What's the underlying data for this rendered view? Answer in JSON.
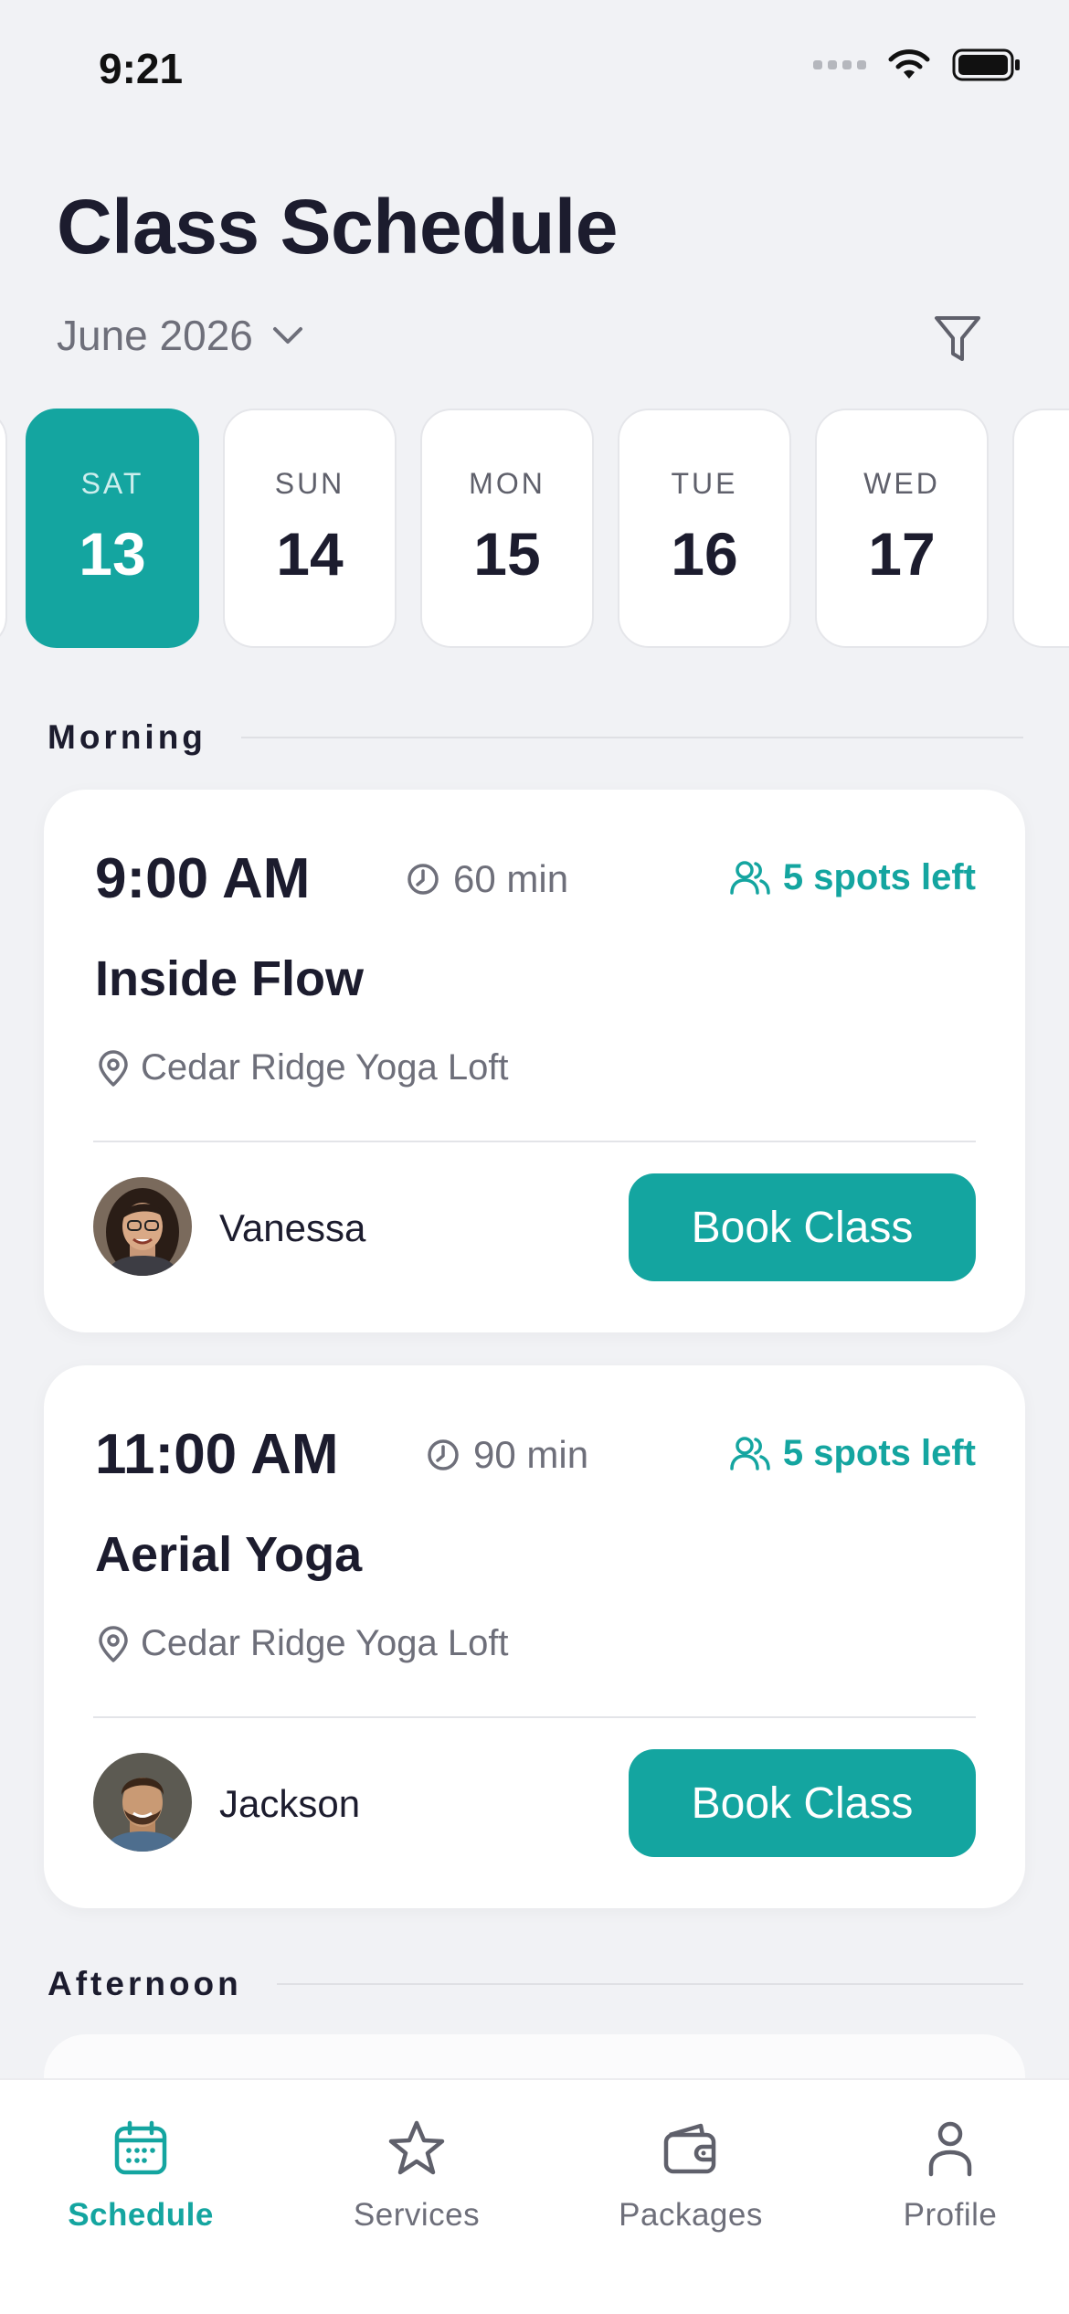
{
  "status_bar": {
    "time": "9:21"
  },
  "header": {
    "title": "Class Schedule",
    "month": "June 2026"
  },
  "dates": [
    {
      "dow": "SAT",
      "day": "13",
      "active": true
    },
    {
      "dow": "SUN",
      "day": "14",
      "active": false
    },
    {
      "dow": "MON",
      "day": "15",
      "active": false
    },
    {
      "dow": "TUE",
      "day": "16",
      "active": false
    },
    {
      "dow": "WED",
      "day": "17",
      "active": false
    }
  ],
  "sections": {
    "morning": "Morning",
    "afternoon": "Afternoon"
  },
  "classes": [
    {
      "time": "9:00 AM",
      "duration": "60 min",
      "spots": "5 spots left",
      "name": "Inside Flow",
      "location": "Cedar Ridge Yoga Loft",
      "instructor": "Vanessa",
      "button": "Book Class"
    },
    {
      "time": "11:00 AM",
      "duration": "90 min",
      "spots": "5 spots left",
      "name": "Aerial Yoga",
      "location": "Cedar Ridge Yoga Loft",
      "instructor": "Jackson",
      "button": "Book Class"
    }
  ],
  "tabs": [
    {
      "label": "Schedule",
      "icon": "calendar-icon",
      "active": true
    },
    {
      "label": "Services",
      "icon": "star-icon",
      "active": false
    },
    {
      "label": "Packages",
      "icon": "wallet-icon",
      "active": false
    },
    {
      "label": "Profile",
      "icon": "person-icon",
      "active": false
    }
  ],
  "colors": {
    "accent": "#14a5a0",
    "background": "#f1f2f5",
    "text": "#1c1c2e",
    "muted": "#6e6f7a"
  }
}
